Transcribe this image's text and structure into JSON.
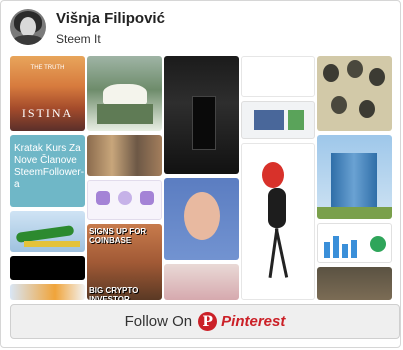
{
  "profile": {
    "name": "Višnja Filipović",
    "subtitle": "Steem It"
  },
  "tiles": {
    "istina": {
      "small_title": "THE TRUTH",
      "word": "ISTINA"
    },
    "kurs": {
      "text": "Kratak Kurs Za Nove Članove SteemFollower-a"
    },
    "meme": {
      "top": "SIGNS UP FOR COINBASE",
      "bottom": "BIG CRYPTO INVESTOR"
    }
  },
  "footer": {
    "follow_label": "Follow On",
    "logo_letter": "P",
    "brand": "Pinterest"
  },
  "colors": {
    "pinterest_red": "#cb2027"
  }
}
